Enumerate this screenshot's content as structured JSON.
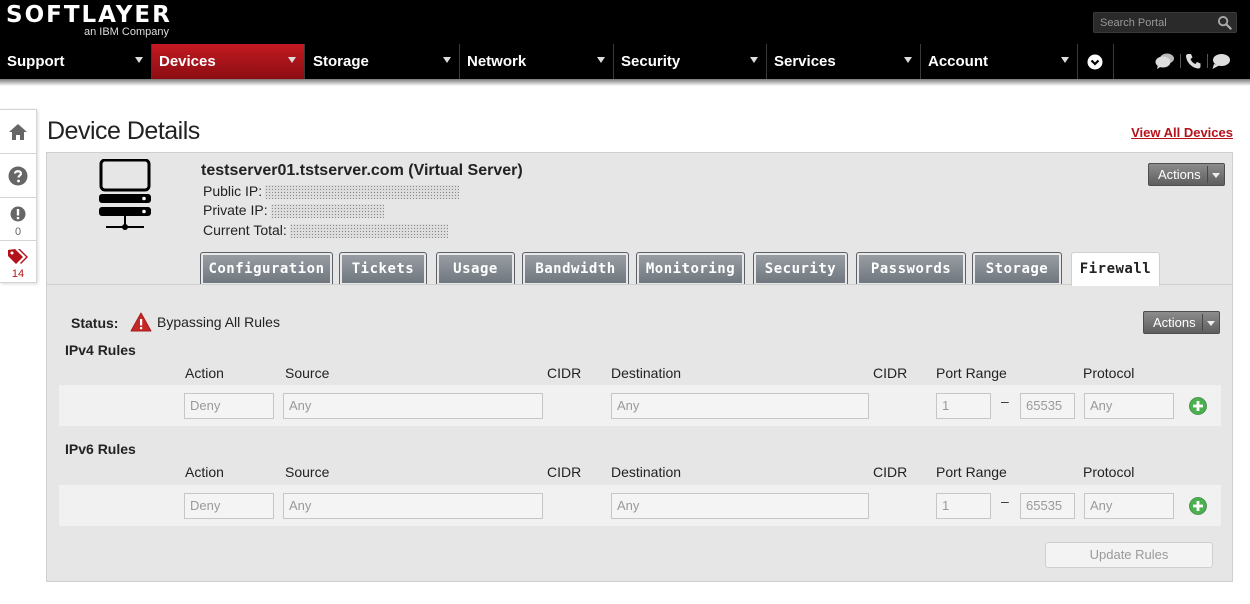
{
  "brand": {
    "name": "SOFTLAYER",
    "tagline": "an IBM Company"
  },
  "search": {
    "placeholder": "Search Portal"
  },
  "nav": {
    "items": [
      {
        "label": "Support"
      },
      {
        "label": "Devices"
      },
      {
        "label": "Storage"
      },
      {
        "label": "Network"
      },
      {
        "label": "Security"
      },
      {
        "label": "Services"
      },
      {
        "label": "Account"
      }
    ]
  },
  "sidebar": {
    "alerts_count": "0",
    "tags_count": "14"
  },
  "page": {
    "title": "Device Details",
    "view_all": "View All Devices"
  },
  "device": {
    "name": "testserver01.tstserver.com (Virtual Server)",
    "public_ip_label": "Public IP:",
    "private_ip_label": "Private IP:",
    "current_total_label": "Current Total:",
    "actions_label": "Actions"
  },
  "tabs": [
    {
      "label": "Configuration"
    },
    {
      "label": "Tickets"
    },
    {
      "label": "Usage"
    },
    {
      "label": "Bandwidth"
    },
    {
      "label": "Monitoring"
    },
    {
      "label": "Security"
    },
    {
      "label": "Passwords"
    },
    {
      "label": "Storage"
    },
    {
      "label": "Firewall"
    }
  ],
  "firewall": {
    "status_label": "Status:",
    "status_value": "Bypassing All Rules",
    "actions_label": "Actions",
    "columns": {
      "action": "Action",
      "source": "Source",
      "cidr": "CIDR",
      "destination": "Destination",
      "cidr2": "CIDR",
      "port_range": "Port Range",
      "protocol": "Protocol"
    },
    "ipv4": {
      "title": "IPv4 Rules",
      "row": {
        "action": "Deny",
        "source": "Any",
        "destination": "Any",
        "port_from": "1",
        "port_to": "65535",
        "protocol": "Any",
        "dash": "–"
      }
    },
    "ipv6": {
      "title": "IPv6 Rules",
      "row": {
        "action": "Deny",
        "source": "Any",
        "destination": "Any",
        "port_from": "1",
        "port_to": "65535",
        "protocol": "Any",
        "dash": "–"
      }
    },
    "update_label": "Update Rules"
  },
  "colors": {
    "brand_red": "#b3121a",
    "nav_active": "#c41a22",
    "add_green": "#4caf50",
    "warning_red": "#c62828"
  }
}
